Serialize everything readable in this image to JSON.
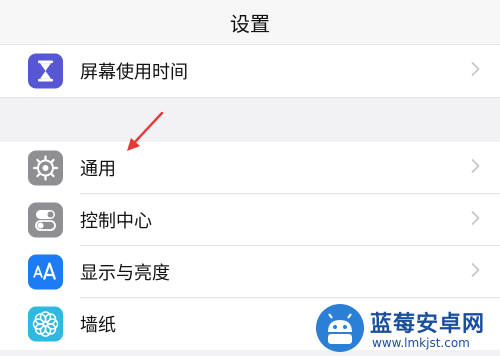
{
  "nav": {
    "title": "设置"
  },
  "group1": [
    {
      "label": "屏幕使用时间",
      "icon": "hourglass-icon",
      "color": "#5757d6"
    }
  ],
  "group2": [
    {
      "label": "通用",
      "icon": "gear-icon",
      "color": "#8e8e93"
    },
    {
      "label": "控制中心",
      "icon": "toggle-icon",
      "color": "#8e8e93"
    },
    {
      "label": "显示与亮度",
      "icon": "text-size-icon",
      "color": "#1b7cf5"
    },
    {
      "label": "墙纸",
      "icon": "flower-icon",
      "color": "#2fb8e0"
    }
  ],
  "watermark": {
    "name": "蓝莓安卓网",
    "url": "www.lmkjst.com",
    "icon": "android-robot-icon"
  },
  "annotation": {
    "color": "#e53935"
  }
}
